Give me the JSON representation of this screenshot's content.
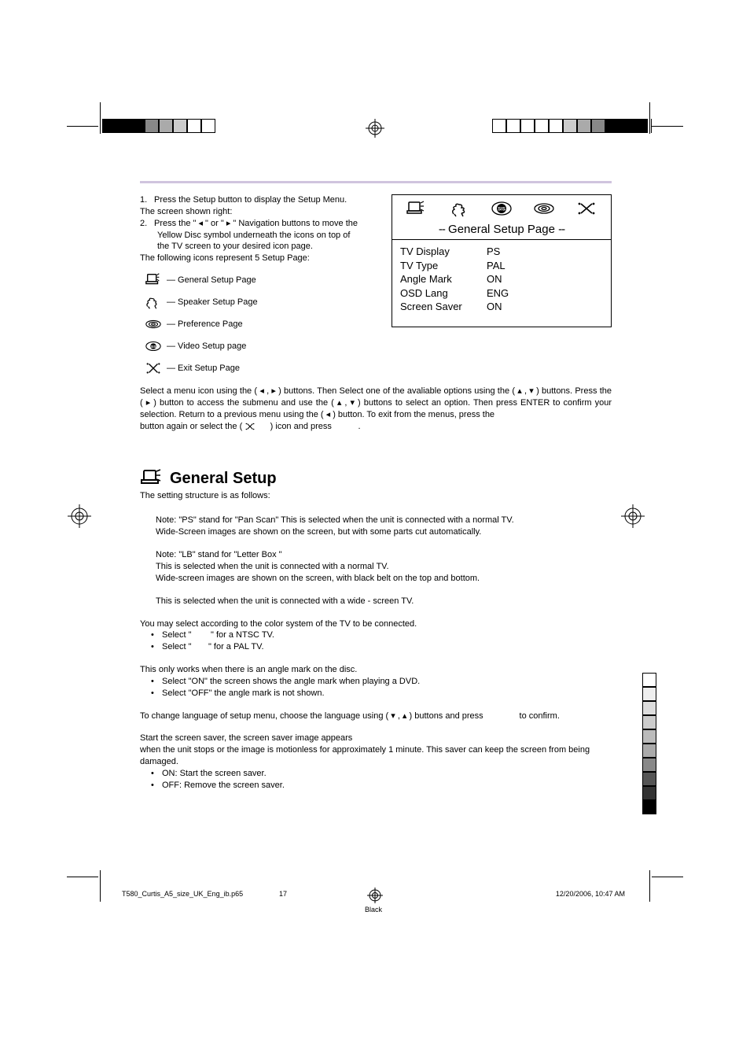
{
  "intro": {
    "step1_num": "1.",
    "step1": "Press the Setup button to display the Setup Menu.",
    "screen_line": "The screen shown right:",
    "step2_num": "2.",
    "step2a": "Press the \" ◂ \" or \" ▸ \" Navigation buttons to move the",
    "step2b": "Yellow Disc symbol underneath the icons on top of",
    "step2c": "the TV screen to your desired icon page.",
    "following": "The following icons represent 5 Setup Page:"
  },
  "legend": {
    "general": "— General Setup Page",
    "speaker": "— Speaker Setup Page",
    "preference": "— Preference Page",
    "video": "— Video Setup page",
    "exit": "— Exit Setup Page"
  },
  "menu": {
    "title_pre": "--",
    "title_mid": " General  Setup  Page ",
    "title_post": "--",
    "rows": [
      {
        "k": "TV Display",
        "v": "PS"
      },
      {
        "k": "TV Type",
        "v": "PAL"
      },
      {
        "k": "Angle Mark",
        "v": "ON"
      },
      {
        "k": "OSD Lang",
        "v": "ENG"
      },
      {
        "k": "Screen Saver",
        "v": "ON"
      }
    ]
  },
  "para1": "Select a menu icon using the ( ◂ , ▸ ) buttons. Then Select one of the avaliable options using the ( ▴ , ▾ ) buttons. Press the ( ▸ ) button to access the submenu and use the ( ▴ , ▾ ) buttons to select an option. Then press ENTER to confirm your selection. Return to a previous menu using the ( ◂ )  button. To exit from the menus, press the",
  "para1_tail_a": "button again or select the (",
  "para1_tail_b": ") icon and press",
  "para1_tail_c": ".",
  "section": {
    "title": "General Setup",
    "sub": "The setting structure is as follows:"
  },
  "blocks": {
    "ps1": "Note: \"PS\" stand for \"Pan Scan\" This is selected when the unit is connected with a normal TV.",
    "ps2": "Wide-Screen images are shown on the screen, but with some parts cut automatically.",
    "lb1": "Note: \"LB\" stand for \"Letter  Box \"",
    "lb2": "This is selected when the unit is connected with a normal TV.",
    "lb3": "Wide-screen images are shown on the screen, with black belt on the top and bottom.",
    "wide": "This is selected when the unit is connected with a wide - screen TV.",
    "tvtype_intro": "You may select according to the color system of the TV to be connected.",
    "tvtype_b1a": "Select \"",
    "tvtype_b1b": "\" for a NTSC TV.",
    "tvtype_b2a": "Select \"",
    "tvtype_b2b": "\" for a PAL TV.",
    "angle_intro": "This only works when there is an angle mark on the disc.",
    "angle_b1": "Select \"ON\" the screen shows the angle mark when playing a DVD.",
    "angle_b2": "Select \"OFF\" the angle mark is not shown.",
    "osd_a": "To change language of setup menu, choose the language using ( ▾ , ▴ ) buttons and press",
    "osd_b": "to confirm.",
    "ss1": "Start the screen saver, the screen saver image appears",
    "ss2": "when the unit stops or the image is motionless for approximately 1 minute. This saver can keep the screen from being damaged.",
    "ss_b1": "ON: Start the screen saver.",
    "ss_b2": "OFF: Remove the screen saver."
  },
  "footer": {
    "file": "T580_Curtis_A5_size_UK_Eng_ib.p65",
    "page": "17",
    "date": "12/20/2006, 10:47 AM",
    "color": "Black"
  },
  "print_bar_left": [
    "#000",
    "#000",
    "#000",
    "#888",
    "#aaa",
    "#ccc",
    "#fff",
    "#fff"
  ],
  "print_bar_right": [
    "#000",
    "#000",
    "#000",
    "#888",
    "#aaa",
    "#ccc",
    "#fff",
    "#fff",
    "#fff",
    "#fff",
    "#fff"
  ],
  "print_bar_side": [
    "#fff",
    "#eee",
    "#ddd",
    "#ccc",
    "#bbb",
    "#aaa",
    "#888",
    "#555",
    "#333",
    "#000"
  ]
}
